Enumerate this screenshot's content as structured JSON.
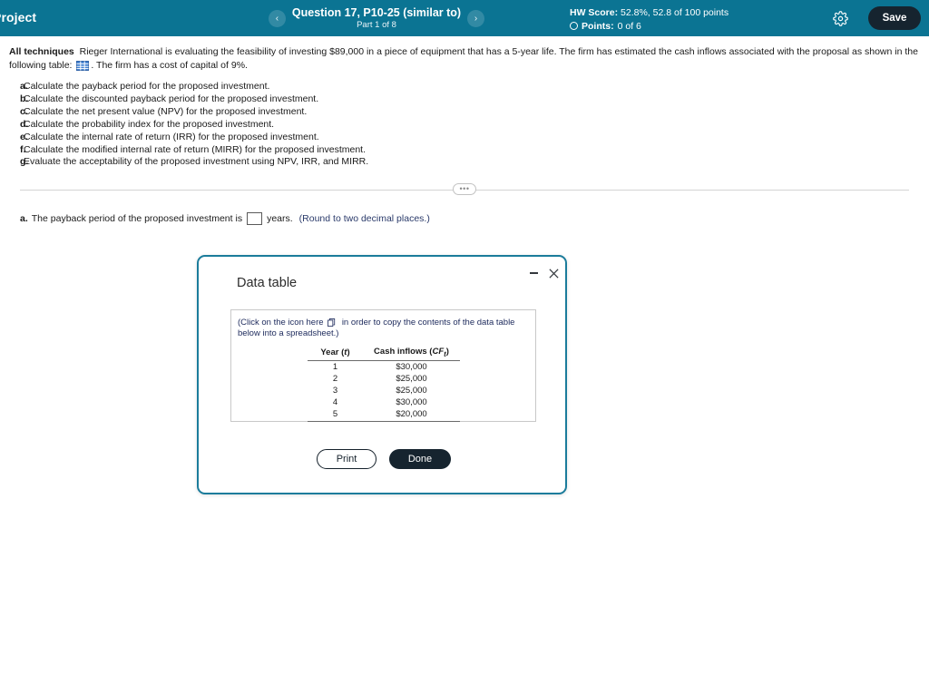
{
  "header": {
    "app_title": "Project",
    "question_title": "Question 17, P10-25 (similar to)",
    "question_part": "Part 1 of 8",
    "prev_arrow": "‹",
    "next_arrow": "›",
    "hw_score_label": "HW Score:",
    "hw_score_value": "52.8%, 52.8 of 100 points",
    "points_label": "Points:",
    "points_value": "0 of 6",
    "save_label": "Save",
    "bar_color": "#0b7493",
    "save_button_color": "#16242f"
  },
  "question": {
    "topic": "All techniques",
    "stem_part1": "Rieger International is evaluating the feasibility of investing $89,000 in a piece of equipment that has a 5-year life. The firm has estimated the cash inflows associated with the proposal as shown in the following table:",
    "stem_part2": ". The firm has a cost of capital of 9%.",
    "parts": [
      {
        "mark": "a.",
        "text": "Calculate the payback period for the proposed investment."
      },
      {
        "mark": "b.",
        "text": "Calculate the discounted payback period for the proposed investment."
      },
      {
        "mark": "c.",
        "text": "Calculate the net present value (NPV) for the proposed investment."
      },
      {
        "mark": "d.",
        "text": "Calculate the probability index for the proposed investment."
      },
      {
        "mark": "e.",
        "text": "Calculate the internal rate of return (IRR) for the proposed investment."
      },
      {
        "mark": "f.",
        "text": "Calculate the modified internal rate of return (MIRR) for the proposed investment."
      },
      {
        "mark": "g.",
        "text": "Evaluate the acceptability of the proposed investment using NPV, IRR, and MIRR."
      }
    ],
    "divider_dots": "•••"
  },
  "answer": {
    "letter": "a.",
    "prompt": "The payback period of the proposed investment is",
    "value": "",
    "unit": "years.",
    "hint": "(Round to two decimal places.)"
  },
  "dialog": {
    "title": "Data table",
    "note_part1": "(Click on the icon here",
    "note_part2": "in order to copy the contents of the data table below into a spreadsheet.)",
    "print_label": "Print",
    "done_label": "Done",
    "border_color": "#1b7c9b"
  },
  "chart_data": {
    "type": "table",
    "title": "Data table",
    "columns": [
      "Year (t)",
      "Cash inflows (CFₜ)"
    ],
    "categories": [
      "1",
      "2",
      "3",
      "4",
      "5"
    ],
    "values": [
      "$30,000",
      "$25,000",
      "$25,000",
      "$30,000",
      "$20,000"
    ],
    "rows": [
      {
        "year": "1",
        "cash_inflow": "$30,000"
      },
      {
        "year": "2",
        "cash_inflow": "$25,000"
      },
      {
        "year": "3",
        "cash_inflow": "$25,000"
      },
      {
        "year": "4",
        "cash_inflow": "$30,000"
      },
      {
        "year": "5",
        "cash_inflow": "$20,000"
      }
    ],
    "header_year": "Year (",
    "header_year_italic": "t",
    "header_year_close": ")",
    "header_cf": "Cash inflows (",
    "header_cf_italic": "CF",
    "header_cf_sub": "t",
    "header_cf_close": ")"
  }
}
